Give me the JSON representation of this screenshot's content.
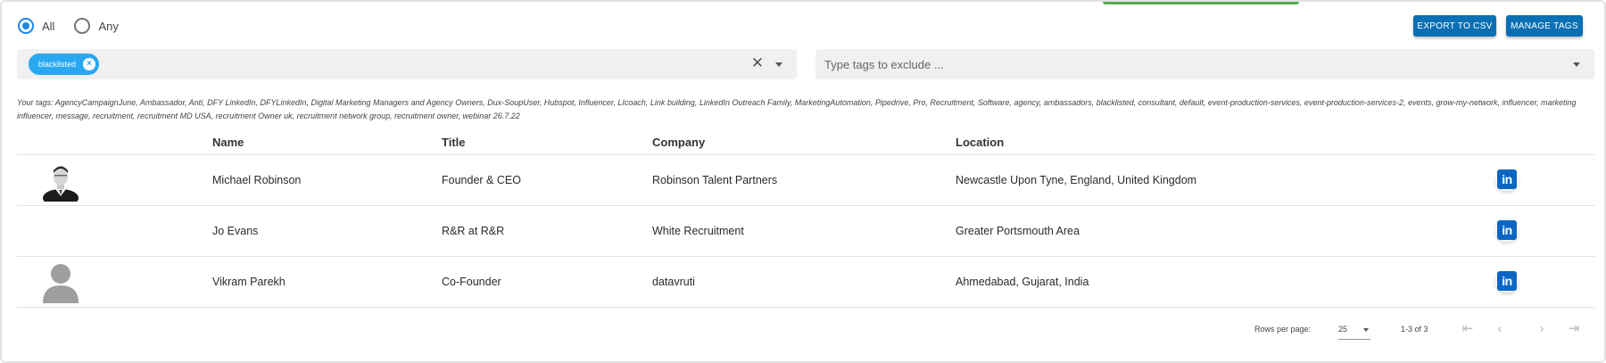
{
  "filter": {
    "match_options": [
      {
        "label": "All",
        "checked": true
      },
      {
        "label": "Any",
        "checked": false
      }
    ]
  },
  "toolbar": {
    "export_label": "EXPORT TO CSV",
    "manage_label": "MANAGE TAGS"
  },
  "include_tags": {
    "chips": [
      "blacklisted"
    ]
  },
  "exclude_tags": {
    "placeholder": "Type tags to exclude ..."
  },
  "tags_note": "Your tags: AgencyCampaignJune, Ambassador, Anti, DFY LinkedIn, DFYLinkedIn, Digital Marketing Managers and Agency Owners, Dux-SoupUser, Hubspot, Influencer, LIcoach, Link building, LinkedIn Outreach Family, MarketingAutomation, Pipedrive, Pro, Recruitment, Software, agency, ambassadors, blacklisted, consultant, default, event-production-services, event-production-services-2, events, grow-my-network, influencer, marketing influencer, message, recruitment, recruitment MD USA, recruitment Owner uk, recruitment network group, recruitment owner, webinar 26.7.22",
  "table": {
    "columns": [
      "Name",
      "Title",
      "Company",
      "Location"
    ],
    "rows": [
      {
        "avatar": "photo",
        "name": "Michael Robinson",
        "title": "Founder & CEO",
        "company": "Robinson Talent Partners",
        "location": "Newcastle Upon Tyne, England, United Kingdom",
        "link": "in"
      },
      {
        "avatar": "none",
        "name": "Jo Evans",
        "title": "R&R at R&R",
        "company": "White Recruitment",
        "location": "Greater Portsmouth Area",
        "link": "in"
      },
      {
        "avatar": "placeholder",
        "name": "Vikram Parekh",
        "title": "Co-Founder",
        "company": "datavruti",
        "location": "Ahmedabad, Gujarat, India",
        "link": "in"
      }
    ]
  },
  "pagination": {
    "rows_per_page_label": "Rows per page:",
    "rows_per_page": "25",
    "range": "1-3 of 3"
  },
  "colors": {
    "primary_button": "#0b6fb3",
    "chip": "#29a8f2",
    "linkedin": "#0a66c2",
    "radio_checked": "#1e88e5"
  }
}
